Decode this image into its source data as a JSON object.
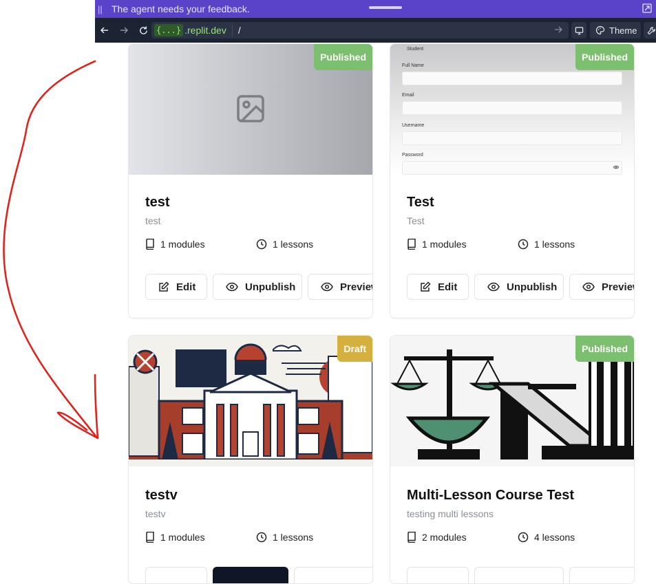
{
  "banner": {
    "message": "The agent needs your feedback."
  },
  "browser": {
    "url_chip": "{...}",
    "url_host": ".replit.dev",
    "url_path": "/",
    "theme_label": "Theme"
  },
  "cards": [
    {
      "title": "test",
      "subtitle": "test",
      "badge": "Published",
      "badge_color": "#7cbf6e",
      "modules": "1 modules",
      "lessons": "1 lessons",
      "buttons": {
        "edit": "Edit",
        "toggle": "Unpublish",
        "preview": "Preview"
      }
    },
    {
      "title": "Test",
      "subtitle": "Test",
      "badge": "Published",
      "badge_color": "#7cbf6e",
      "modules": "1 modules",
      "lessons": "1 lessons",
      "buttons": {
        "edit": "Edit",
        "toggle": "Unpublish",
        "preview": "Preview"
      },
      "form_preview": {
        "role": "Student",
        "full_name": "Full Name",
        "email": "Email",
        "username": "Username",
        "password": "Password"
      }
    },
    {
      "title": "testv",
      "subtitle": "testv",
      "badge": "Draft",
      "badge_color": "#d4b13f",
      "modules": "1 modules",
      "lessons": "1 lessons"
    },
    {
      "title": "Multi-Lesson Course Test",
      "subtitle": "testing multi lessons",
      "badge": "Published",
      "badge_color": "#7cbf6e",
      "modules": "2 modules",
      "lessons": "4 lessons"
    }
  ],
  "annotation_color": "#e0231c"
}
